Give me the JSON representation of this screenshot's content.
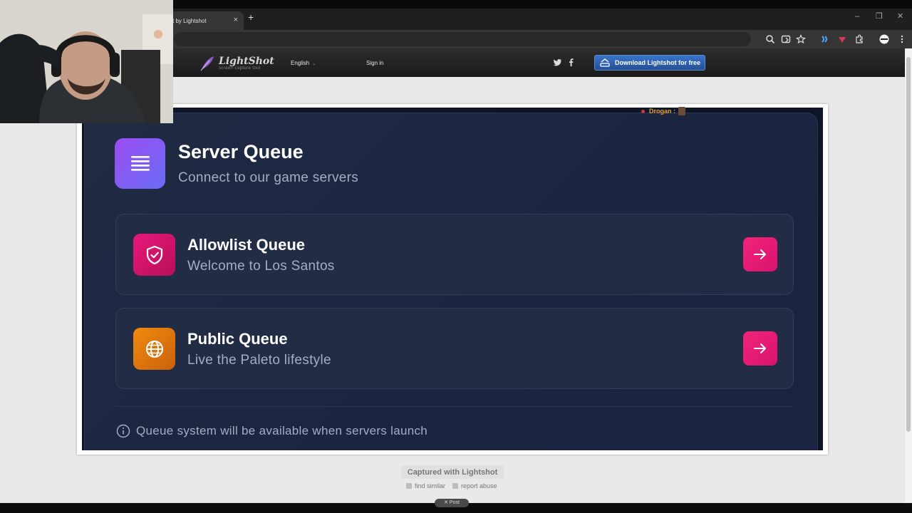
{
  "browser": {
    "tab_title": "t by Lightshot",
    "tab_close": "×",
    "new_tab": "+",
    "window_controls": [
      "–",
      "❐",
      "✕"
    ],
    "toolbar_icons": [
      "zoom-icon",
      "cast-icon",
      "star-icon",
      "extension-blue-icon",
      "extension-red-icon",
      "puzzle-icon",
      "profile-icon",
      "menu-icon"
    ]
  },
  "lightshot": {
    "logo_title": "LightShot",
    "logo_sub": "screen capture tool",
    "language": "English",
    "sign_in": "Sign in",
    "download_label": "Download Lightshot for free",
    "captured_with": "Captured with Lightshot",
    "find_similar": "find similar",
    "report_abuse": "report abuse",
    "post": "✕ Post"
  },
  "screenshot": {
    "overlay_user": "Drogan :",
    "header": {
      "title": "Server Queue",
      "subtitle": "Connect to our game servers",
      "icon": "server-list-icon"
    },
    "cards": [
      {
        "title": "Allowlist Queue",
        "subtitle": "Welcome to Los Santos",
        "icon": "shield-check-icon",
        "color": "#e0146e"
      },
      {
        "title": "Public Queue",
        "subtitle": "Live the Paleto lifestyle",
        "icon": "globe-icon",
        "color": "#e3830c"
      }
    ],
    "info_text": "Queue system will be available when servers launch",
    "accent_color": "#f0207a"
  }
}
